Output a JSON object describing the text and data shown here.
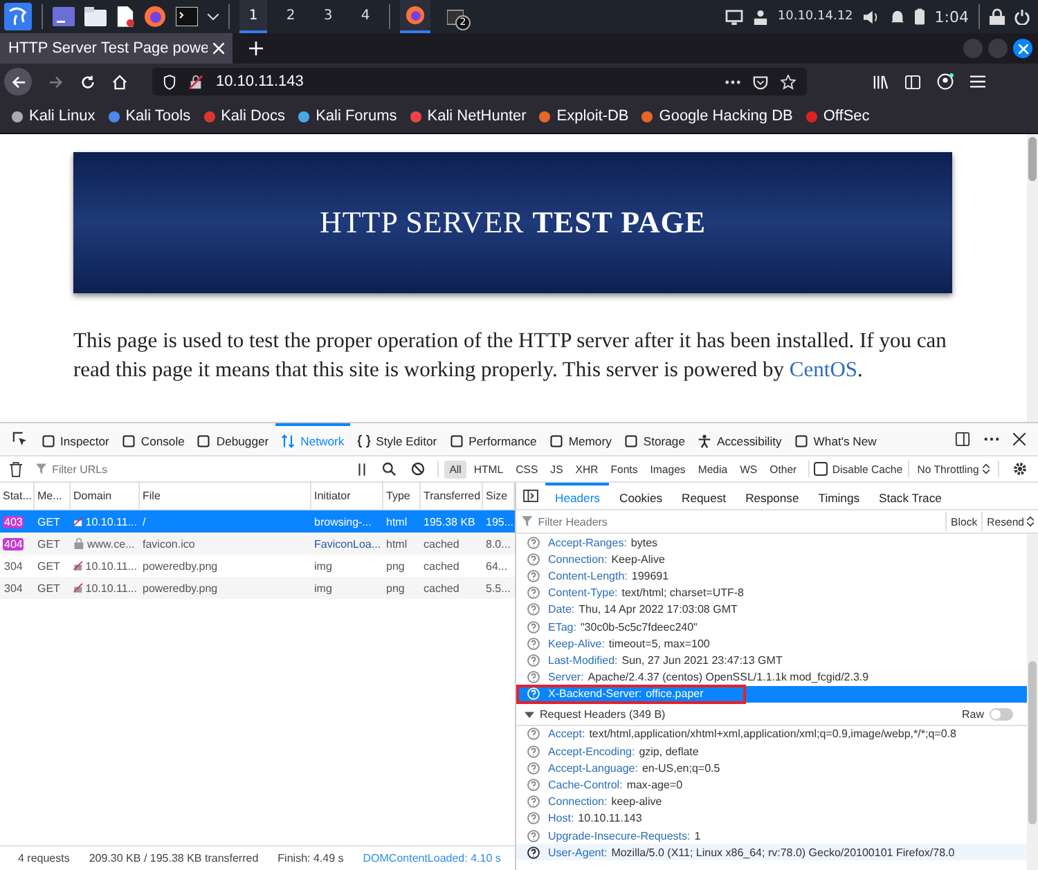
{
  "taskbar": {
    "workspaces": [
      {
        "label": "1",
        "selected": true
      },
      {
        "label": "2",
        "selected": false
      },
      {
        "label": "3",
        "selected": false
      },
      {
        "label": "4",
        "selected": false
      }
    ],
    "terminal_badge": "2",
    "ip": "10.10.14.12",
    "time": "1:04"
  },
  "browser": {
    "tab_title": "HTTP Server Test Page powe",
    "url": "10.10.11.143",
    "bookmarks": [
      "Kali Linux",
      "Kali Tools",
      "Kali Docs",
      "Kali Forums",
      "Kali NetHunter",
      "Exploit-DB",
      "Google Hacking DB",
      "OffSec"
    ]
  },
  "page": {
    "banner_title": "HTTP SERVER **TEST PAGE**",
    "paragraph": "This page is used to test the proper operation of the HTTP server after it has been installed. If you can read this page it means that this site is working properly. This server is powered by ",
    "paragraph_link": "CentOS",
    "paragraph_end": "."
  },
  "devtools": {
    "tabs": [
      {
        "label": "Inspector",
        "selected": false
      },
      {
        "label": "Console",
        "selected": false
      },
      {
        "label": "Debugger",
        "selected": false
      },
      {
        "label": "Network",
        "selected": true
      },
      {
        "label": "Style Editor",
        "selected": false
      },
      {
        "label": "Performance",
        "selected": false
      },
      {
        "label": "Memory",
        "selected": false
      },
      {
        "label": "Storage",
        "selected": false
      },
      {
        "label": "Accessibility",
        "selected": false
      },
      {
        "label": "What's New",
        "selected": false
      }
    ],
    "filter_placeholder": "Filter URLs",
    "type_filters": [
      {
        "label": "All",
        "selected": true
      },
      {
        "label": "HTML",
        "selected": false
      },
      {
        "label": "CSS",
        "selected": false
      },
      {
        "label": "JS",
        "selected": false
      },
      {
        "label": "XHR",
        "selected": false
      },
      {
        "label": "Fonts",
        "selected": false
      },
      {
        "label": "Images",
        "selected": false
      },
      {
        "label": "Media",
        "selected": false
      },
      {
        "label": "WS",
        "selected": false
      },
      {
        "label": "Other",
        "selected": false
      }
    ],
    "disable_cache": {
      "label": "Disable Cache",
      "checked": false
    },
    "throttling": "No Throttling",
    "columns": [
      "Stat...",
      "Me...",
      "Domain",
      "File",
      "Initiator",
      "Type",
      "Transferred",
      "Size"
    ],
    "rows": [
      {
        "status": "403",
        "error_badge": true,
        "method": "GET",
        "secure": false,
        "domain": "10.10.11...",
        "file": "/",
        "initiator": "browsing-...",
        "initiator_link": false,
        "type": "html",
        "transferred": "195.38 KB",
        "size": "195...",
        "selected": true
      },
      {
        "status": "404",
        "error_badge": true,
        "method": "GET",
        "secure": true,
        "domain": "www.ce...",
        "file": "favicon.ico",
        "initiator": "FaviconLoa...",
        "initiator_link": true,
        "type": "html",
        "transferred": "cached",
        "size": "8.0...",
        "selected": false
      },
      {
        "status": "304",
        "error_badge": false,
        "method": "GET",
        "secure": false,
        "domain": "10.10.11...",
        "file": "poweredby.png",
        "initiator": "img",
        "initiator_link": false,
        "type": "png",
        "transferred": "cached",
        "size": "64...",
        "selected": false
      },
      {
        "status": "304",
        "error_badge": false,
        "method": "GET",
        "secure": false,
        "domain": "10.10.11...",
        "file": "poweredby.png",
        "initiator": "img",
        "initiator_link": false,
        "type": "png",
        "transferred": "cached",
        "size": "5.5...",
        "selected": false
      }
    ],
    "detail_tabs": [
      {
        "label": "Headers",
        "selected": true
      },
      {
        "label": "Cookies",
        "selected": false
      },
      {
        "label": "Request",
        "selected": false
      },
      {
        "label": "Response",
        "selected": false
      },
      {
        "label": "Timings",
        "selected": false
      },
      {
        "label": "Stack Trace",
        "selected": false
      }
    ],
    "headers_filter_placeholder": "Filter Headers",
    "block_button": "Block",
    "resend_button": "Resend",
    "response_headers": [
      {
        "name": "Accept-Ranges:",
        "value": "bytes",
        "selected": false
      },
      {
        "name": "Connection:",
        "value": "Keep-Alive",
        "selected": false
      },
      {
        "name": "Content-Length:",
        "value": "199691",
        "selected": false
      },
      {
        "name": "Content-Type:",
        "value": "text/html; charset=UTF-8",
        "selected": false
      },
      {
        "name": "Date:",
        "value": "Thu, 14 Apr 2022 17:03:08 GMT",
        "selected": false
      },
      {
        "name": "ETag:",
        "value": "\"30c0b-5c5c7fdeec240\"",
        "selected": false
      },
      {
        "name": "Keep-Alive:",
        "value": "timeout=5, max=100",
        "selected": false
      },
      {
        "name": "Last-Modified:",
        "value": "Sun, 27 Jun 2021 23:47:13 GMT",
        "selected": false
      },
      {
        "name": "Server:",
        "value": "Apache/2.4.37 (centos) OpenSSL/1.1.1k mod_fcgid/2.3.9",
        "selected": false
      },
      {
        "name": "X-Backend-Server:",
        "value": "office.paper",
        "selected": true,
        "highlighted_box": true
      }
    ],
    "request_section": {
      "title": "Request Headers (349 B)",
      "expanded": true,
      "raw_label": "Raw",
      "raw_on": false
    },
    "request_headers": [
      {
        "name": "Accept:",
        "value": "text/html,application/xhtml+xml,application/xml;q=0.9,image/webp,*/*;q=0.8",
        "hovered": false
      },
      {
        "name": "Accept-Encoding:",
        "value": "gzip, deflate",
        "hovered": false
      },
      {
        "name": "Accept-Language:",
        "value": "en-US,en;q=0.5",
        "hovered": false
      },
      {
        "name": "Cache-Control:",
        "value": "max-age=0",
        "hovered": false
      },
      {
        "name": "Connection:",
        "value": "keep-alive",
        "hovered": false
      },
      {
        "name": "Host:",
        "value": "10.10.11.143",
        "hovered": false
      },
      {
        "name": "Upgrade-Insecure-Requests:",
        "value": "1",
        "hovered": false
      },
      {
        "name": "User-Agent:",
        "value": "Mozilla/5.0 (X11; Linux x86_64; rv:78.0) Gecko/20100101 Firefox/78.0",
        "hovered": true
      }
    ],
    "status_bar": [
      {
        "text": "4 requests",
        "link": false
      },
      {
        "text": "209.30 KB / 195.38 KB transferred",
        "link": false
      },
      {
        "text": "Finish: 4.49 s",
        "link": false
      },
      {
        "text": "DOMContentLoaded: 4.10 s",
        "link": true
      }
    ]
  }
}
